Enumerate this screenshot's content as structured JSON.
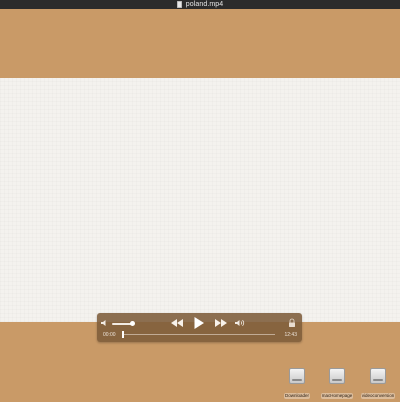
{
  "window": {
    "title": "poland.mp4",
    "title_icon": "document-icon"
  },
  "player": {
    "elapsed": "00:00",
    "total": "12:43",
    "progress": 0,
    "volume": 0.8,
    "icons": {
      "volume_low": "volume-low-icon",
      "volume_high": "volume-high-icon",
      "rewind": "rewind-icon",
      "play": "play-icon",
      "fast_forward": "fast-forward-icon",
      "lock": "lock-icon"
    }
  },
  "desktop": {
    "items": [
      {
        "label": "Downloader",
        "icon": "hard-drive-icon"
      },
      {
        "label": "macHomepage",
        "icon": "hard-drive-icon"
      },
      {
        "label": "videoconversion",
        "icon": "hard-drive-icon"
      }
    ]
  },
  "colors": {
    "desktop": "#c99a67",
    "page": "#f4f2ee",
    "controls": "#7d5c3a",
    "titlebar": "#2b2b2b"
  }
}
